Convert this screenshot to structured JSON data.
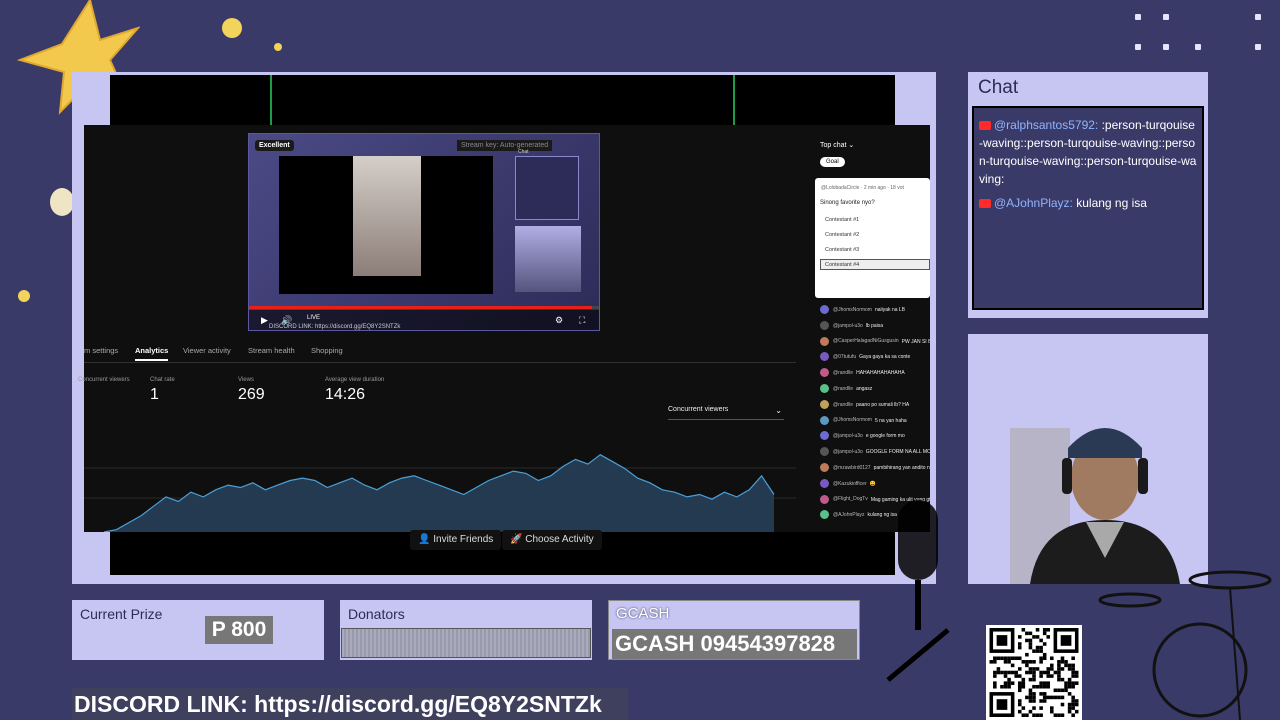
{
  "stream_preview": {
    "quality_badge": "Excellent",
    "stream_key_label": "Stream key: Auto-generated",
    "chat_label": "Chat",
    "live_label": "LIVE",
    "discord_small": "DISCORD LINK: https://discord.gg/EQ8Y2SNTZk"
  },
  "analytics": {
    "tabs": [
      "m settings",
      "Analytics",
      "Viewer activity",
      "Stream health",
      "Shopping"
    ],
    "active_tab": "Analytics",
    "stats": [
      {
        "label": "Concurrent viewers",
        "value": ""
      },
      {
        "label": "Chat rate",
        "value": "1"
      },
      {
        "label": "Views",
        "value": "269"
      },
      {
        "label": "Average view duration",
        "value": "14:26"
      }
    ],
    "dropdown_label": "Concurrent viewers",
    "chart_data": {
      "type": "area",
      "series": [
        {
          "values": [
            0,
            2,
            8,
            14,
            22,
            30,
            26,
            34,
            30,
            36,
            40,
            38,
            42,
            36,
            40,
            44,
            46,
            44,
            38,
            42,
            46,
            40,
            36,
            42,
            46,
            48,
            44,
            40,
            36,
            32,
            38,
            44,
            48,
            52,
            50,
            44,
            48,
            56,
            62,
            58,
            66,
            60,
            54,
            46,
            42,
            36,
            34,
            30,
            32,
            28,
            34,
            30,
            36,
            48,
            32
          ]
        }
      ]
    }
  },
  "yt_chat": {
    "header": "Top chat",
    "goal_chip": "Goal",
    "poll": {
      "meta": "@LolobadaCircle · 2 min ago · 18 vot",
      "question": "Sinong favorite nyo?",
      "options": [
        "Contestant #1",
        "Contestant #2",
        "Contestant #3",
        "Contestant #4"
      ],
      "selected_index": 3
    },
    "messages": [
      {
        "name": "@JhomsNormom",
        "text": "naiiyak na LB"
      },
      {
        "name": "@jampol-u3o",
        "text": "lb paisa"
      },
      {
        "name": "@CasperHalagadNiGusgusin",
        "text": "PW JAN SI BEST FRIEND KONG SI FL"
      },
      {
        "name": "@07tutufu",
        "text": "Gaya gaya ka sa conte"
      },
      {
        "name": "@randlle",
        "text": "HAHAHAHAHAHAHA"
      },
      {
        "name": "@randlle",
        "text": "angasz"
      },
      {
        "name": "@randlle",
        "text": "paano po sumali lb? HA"
      },
      {
        "name": "@JhomsNormom",
        "text": "5 na yan haha"
      },
      {
        "name": "@jampol-u3o",
        "text": "e google form mo"
      },
      {
        "name": "@jampol-u3o",
        "text": "GOOGLE FORM NA ALL MO NALANG"
      },
      {
        "name": "@mzawbird0127",
        "text": "pambihirang yan andito na din sinadakop tayo kam"
      },
      {
        "name": "@Kazukiofficer",
        "text": "😀"
      },
      {
        "name": "@Flight_DogTv",
        "text": "Mag gaming ka ulit yung gta 5 mo"
      },
      {
        "name": "@AJohnPlayz",
        "text": "kulang ng isa"
      }
    ]
  },
  "buttons": {
    "invite": "Invite Friends",
    "choose_activity": "Choose Activity"
  },
  "chat_panel": {
    "title": "Chat",
    "messages": [
      {
        "user": "@ralphsantos5792:",
        "text": ":person-turqouise-waving::person-turqouise-waving::person-turqouise-waving::person-turqouise-waving:"
      },
      {
        "user": "@AJohnPlayz:",
        "text": "kulang ng isa"
      }
    ]
  },
  "prize": {
    "label": "Current Prize",
    "value": "P 800"
  },
  "donators": {
    "label": "Donators"
  },
  "gcash": {
    "label": "GCASH",
    "value": "GCASH 09454397828"
  },
  "discord": {
    "text": "DISCORD LINK: https://discord.gg/EQ8Y2SNTZk"
  },
  "colors": {
    "background": "#3a3a68",
    "panel": "#c7c6f2",
    "accent_red": "#e62117",
    "star": "#f2d35b"
  }
}
